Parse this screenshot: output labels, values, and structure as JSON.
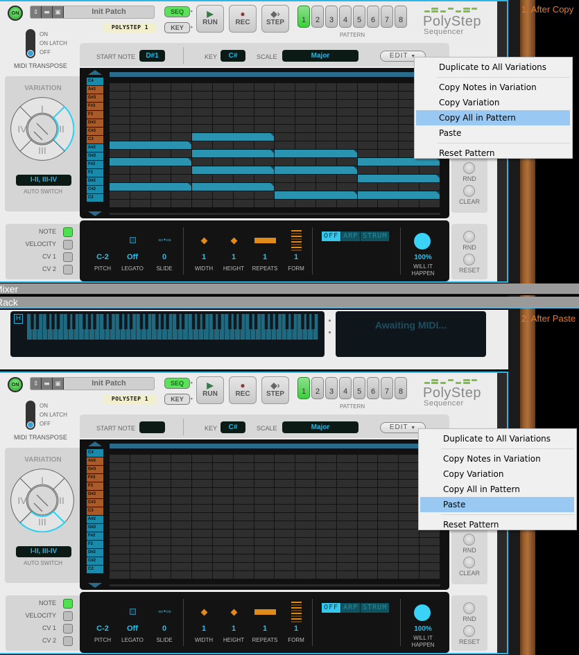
{
  "captions": {
    "first": "1. After Copy",
    "second": "2. After Paste"
  },
  "strips": {
    "mixer": "Mixer",
    "rack": "Rack"
  },
  "keyboard_device": {
    "hold_label": "H",
    "midi_status": "Awaiting MIDI..."
  },
  "device_common": {
    "on_label": "ON",
    "patch_name": "Init Patch",
    "tape_label": "POLYSTEP 1",
    "seq_label": "SEQ",
    "key_label": "KEY",
    "run_label": "RUN",
    "rec_label": "REC",
    "step_label": "STEP",
    "patterns": [
      "1",
      "2",
      "3",
      "4",
      "5",
      "6",
      "7",
      "8"
    ],
    "active_pattern": 1,
    "pattern_label": "PATTERN",
    "logo_name": "PolyStep",
    "logo_sub": "Sequencer",
    "transpose_options": [
      "ON",
      "ON LATCH",
      "OFF"
    ],
    "transpose_selected": "OFF",
    "transpose_label": "MIDI TRANSPOSE",
    "start_note_label": "START NOTE",
    "key_field_label": "KEY",
    "key_value": "C#",
    "scale_label": "SCALE",
    "scale_value": "Major",
    "edit_label": "EDIT",
    "variation_title": "VARIATION",
    "variation_segments": [
      "I",
      "II",
      "III",
      "IV"
    ],
    "auto_switch_value": "I-II, III-IV",
    "auto_switch_label": "AUTO SWITCH",
    "row_notes": [
      "C4",
      "A#3",
      "G#3",
      "F#3",
      "F3",
      "D#3",
      "C#3",
      "C3",
      "A#2",
      "G#2",
      "F#2",
      "F2",
      "D#2",
      "C#2",
      "C2"
    ],
    "row_colors": [
      "blue",
      "orange",
      "orange",
      "orange",
      "orange",
      "orange",
      "orange",
      "orange",
      "blue",
      "blue",
      "blue",
      "blue",
      "blue",
      "blue",
      "blue"
    ],
    "steps": 16,
    "rnd_label": "RND",
    "clear_label": "CLEAR",
    "reset_label": "RESET",
    "lanes": [
      {
        "label": "NOTE",
        "on": true
      },
      {
        "label": "VELOCITY",
        "on": false
      },
      {
        "label": "CV 1",
        "on": false
      },
      {
        "label": "CV 2",
        "on": false
      }
    ],
    "params": [
      {
        "label": "PITCH",
        "value": "C-2",
        "icon": "none"
      },
      {
        "label": "LEGATO",
        "value": "Off",
        "icon": "square-icon"
      },
      {
        "label": "SLIDE",
        "value": "0",
        "icon": "slide-icon"
      },
      {
        "label": "WIDTH",
        "value": "1",
        "icon": "diamond-icon"
      },
      {
        "label": "HEIGHT",
        "value": "1",
        "icon": "diamond-icon"
      },
      {
        "label": "REPEATS",
        "value": "1",
        "icon": "bar-icon"
      },
      {
        "label": "FORM",
        "value": "1",
        "icon": "form-icon"
      }
    ],
    "modes": [
      "OFF",
      "ARP",
      "STRUM"
    ],
    "active_mode": "OFF",
    "probability_value": "100%",
    "probability_label": "WILL IT HAPPEN",
    "menu_items": [
      "Duplicate to All Variations",
      "Copy Notes in Variation",
      "Copy Variation",
      "Copy All in Pattern",
      "Paste",
      "Reset Pattern"
    ]
  },
  "device1": {
    "start_note_value": "D#1",
    "active_variation": "II",
    "menu_highlight": "Copy All in Pattern",
    "notes": [
      {
        "note": "C3",
        "start": 1,
        "end": 4
      },
      {
        "note": "G#2",
        "start": 1,
        "end": 4
      },
      {
        "note": "D#2",
        "start": 1,
        "end": 4
      },
      {
        "note": "C#3",
        "start": 5,
        "end": 8
      },
      {
        "note": "A#2",
        "start": 5,
        "end": 8
      },
      {
        "note": "F#2",
        "start": 5,
        "end": 8
      },
      {
        "note": "D#2",
        "start": 5,
        "end": 8
      },
      {
        "note": "A#2",
        "start": 9,
        "end": 12
      },
      {
        "note": "F#2",
        "start": 9,
        "end": 12
      },
      {
        "note": "C#2",
        "start": 9,
        "end": 12
      },
      {
        "note": "G#2",
        "start": 13,
        "end": 16
      },
      {
        "note": "F2",
        "start": 13,
        "end": 16
      },
      {
        "note": "C#2",
        "start": 13,
        "end": 16
      }
    ]
  },
  "device2": {
    "start_note_value": "",
    "active_variation": "III",
    "menu_highlight": "Paste",
    "notes": []
  }
}
